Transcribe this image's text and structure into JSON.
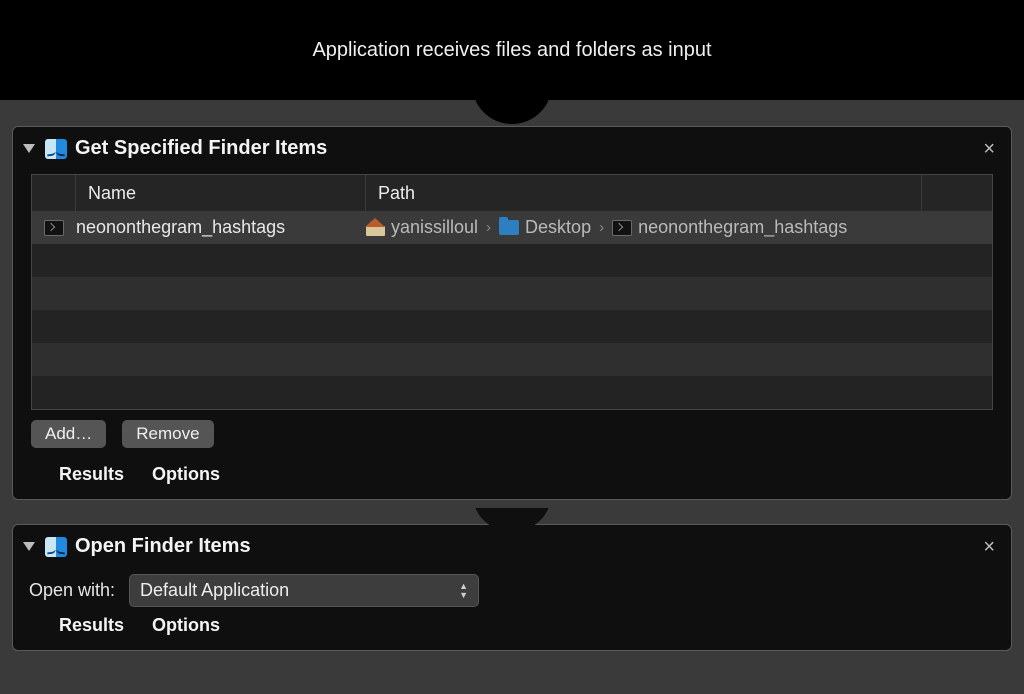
{
  "header": {
    "title": "Application receives files and folders as input"
  },
  "actions": [
    {
      "title": "Get Specified Finder Items",
      "table": {
        "columns": {
          "name": "Name",
          "path": "Path"
        },
        "rows": [
          {
            "name": "neononthegram_hashtags",
            "path_segments": [
              "yanissilloul",
              "Desktop",
              "neononthegram_hashtags"
            ]
          }
        ],
        "empty_rows": 5
      },
      "buttons": {
        "add": "Add…",
        "remove": "Remove"
      },
      "footer": {
        "results": "Results",
        "options": "Options"
      }
    },
    {
      "title": "Open Finder Items",
      "open_with_label": "Open with:",
      "open_with_value": "Default Application",
      "footer": {
        "results": "Results",
        "options": "Options"
      }
    }
  ]
}
